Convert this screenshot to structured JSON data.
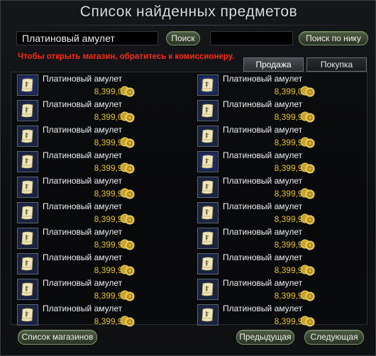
{
  "window": {
    "title": "Список найденных предметов"
  },
  "search": {
    "item_value": "Платиновый амулет",
    "search_button": "Поиск",
    "nick_value": "",
    "nick_button": "Поиск по нику"
  },
  "warning": "Чтобы открыть магазин, обратитесь к комиссионеру.",
  "tabs": [
    {
      "label": "Продажа",
      "active": true
    },
    {
      "label": "Покупка",
      "active": false
    }
  ],
  "items_left": [
    {
      "name": "Платиновый амулет",
      "price": "8,399,000",
      "icon": "scroll-icon-blue"
    },
    {
      "name": "Платиновый амулет",
      "price": "8,399,000",
      "icon": "scroll-icon"
    },
    {
      "name": "Платиновый амулет",
      "price": "8,399,997",
      "icon": "scroll-icon"
    },
    {
      "name": "Платиновый амулет",
      "price": "8,399,997",
      "icon": "scroll-icon"
    },
    {
      "name": "Платиновый амулет",
      "price": "8,399,997",
      "icon": "scroll-icon"
    },
    {
      "name": "Платиновый амулет",
      "price": "8,399,998",
      "icon": "scroll-icon"
    },
    {
      "name": "Платиновый амулет",
      "price": "8,399,998",
      "icon": "scroll-icon"
    },
    {
      "name": "Платиновый амулет",
      "price": "8,399,998",
      "icon": "scroll-icon"
    },
    {
      "name": "Платиновый амулет",
      "price": "8,399,998",
      "icon": "scroll-icon"
    },
    {
      "name": "Платиновый амулет",
      "price": "8,399,998",
      "icon": "scroll-icon"
    }
  ],
  "items_right": [
    {
      "name": "Платиновый амулет",
      "price": "8,399,000",
      "icon": "scroll-icon-blue"
    },
    {
      "name": "Платиновый амулет",
      "price": "8,399,997",
      "icon": "scroll-icon"
    },
    {
      "name": "Платиновый амулет",
      "price": "8,399,997",
      "icon": "scroll-icon"
    },
    {
      "name": "Платиновый амулет",
      "price": "8,399,997",
      "icon": "scroll-icon-blue"
    },
    {
      "name": "Платиновый амулет",
      "price": "8,399,997",
      "icon": "scroll-icon"
    },
    {
      "name": "Платиновый амулет",
      "price": "8,399,998",
      "icon": "scroll-icon"
    },
    {
      "name": "Платиновый амулет",
      "price": "8,399,998",
      "icon": "scroll-icon"
    },
    {
      "name": "Платиновый амулет",
      "price": "8,399,998",
      "icon": "scroll-icon"
    },
    {
      "name": "Платиновый амулет",
      "price": "8,399,998",
      "icon": "scroll-icon"
    },
    {
      "name": "Платиновый амулет",
      "price": "8,399,998",
      "icon": "scroll-icon"
    }
  ],
  "footer": {
    "shops_button": "Список магазинов",
    "prev_button": "Предыдущая",
    "next_button": "Следующая"
  },
  "colors": {
    "price": "#e6c23a",
    "warning": "#ff2a1a",
    "button_border": "#7f9a6a"
  }
}
